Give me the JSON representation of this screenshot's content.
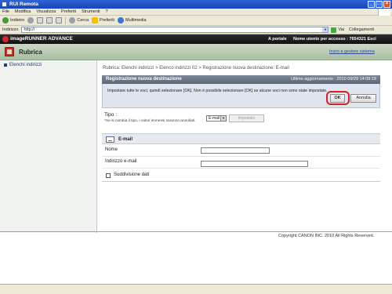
{
  "window": {
    "title": "RUI Remota"
  },
  "menubar": {
    "items": [
      "File",
      "Modifica",
      "Visualizza",
      "Preferiti",
      "Strumenti",
      "?"
    ]
  },
  "toolbar": {
    "back": "Indietro",
    "search": "Cerca",
    "favorites": "Preferiti",
    "multimedia": "Multimedia"
  },
  "addressbar": {
    "label": "Indirizzo",
    "url": "http://",
    "go": "Vai",
    "links": "Collegamenti"
  },
  "brand": {
    "product": "imageRUNNER ADVANCE",
    "portal": "A portale",
    "user": "Nome utente per accesso : 7654321 Esci"
  },
  "header": {
    "title": "Rubrica",
    "home_link": "Inizio a gestore sistema"
  },
  "sidebar": {
    "items": [
      {
        "label": "Elenchi indirizzi"
      }
    ]
  },
  "breadcrumb": {
    "part1": "Rubrica: Elenchi indirizzi",
    "sep": " > ",
    "part2": "Elenco indirizzi 02",
    "part3": "Registrazione nuova destinazione: E-mail"
  },
  "panel": {
    "title": "Registrazione nuova destinazione",
    "updated": "Ultimo aggiornamento : 2010 09/29 14:09:19",
    "instructions": "Impostare tutte le voci, quindi selezionare [OK]. Non è possibile selezionare [OK] se alcune voci non sono state impostate.",
    "ok": "OK",
    "cancel": "Annulla"
  },
  "tipo": {
    "label": "Tipo :",
    "note": "*Se si cambia il tipo, i valori immessi saranno annullati.",
    "selected": "E-mail",
    "set_button": "Impostato"
  },
  "form": {
    "section_title": "E-mail",
    "fields": [
      {
        "label": "Nome",
        "value": ""
      },
      {
        "label": "Indirizzo e-mail",
        "value": ""
      }
    ],
    "checkbox_label": "Suddivisione dati"
  },
  "footer": {
    "copyright": "Copyright CANON INC. 2010 All Rights Reserved."
  }
}
